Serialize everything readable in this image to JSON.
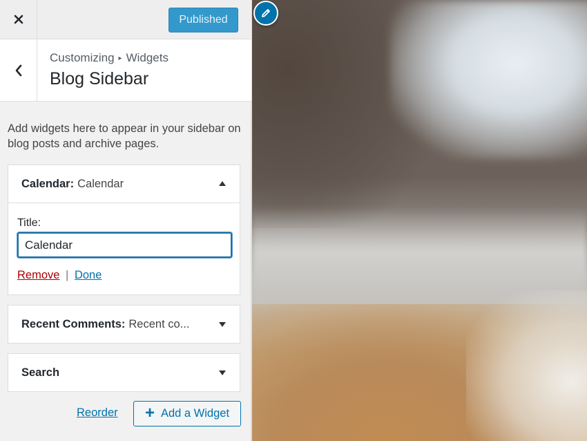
{
  "header": {
    "close_icon": "close-icon",
    "publish_label": "Published"
  },
  "section": {
    "back_icon": "chevron-left-icon",
    "crumb_parent": "Customizing",
    "crumb_separator": "▸",
    "crumb_current": "Widgets",
    "title": "Blog Sidebar",
    "description": "Add widgets here to appear in your sidebar on blog posts and archive pages."
  },
  "widgets": [
    {
      "name": "Calendar",
      "separator": ":",
      "subtitle": "Calendar",
      "expanded": true,
      "title_label": "Title:",
      "title_value": "Calendar",
      "remove_label": "Remove",
      "divider": "|",
      "done_label": "Done"
    },
    {
      "name": "Recent Comments",
      "separator": ":",
      "subtitle": "Recent co...",
      "expanded": false
    },
    {
      "name": "Search",
      "expanded": false
    }
  ],
  "footer": {
    "reorder_label": "Reorder",
    "add_widget_label": "Add a Widget",
    "add_icon": "plus-icon"
  },
  "preview": {
    "edit_icon": "pencil-icon"
  },
  "colors": {
    "accent": "#0073aa",
    "publish_bg": "#3399cc",
    "remove": "#aa0000"
  }
}
